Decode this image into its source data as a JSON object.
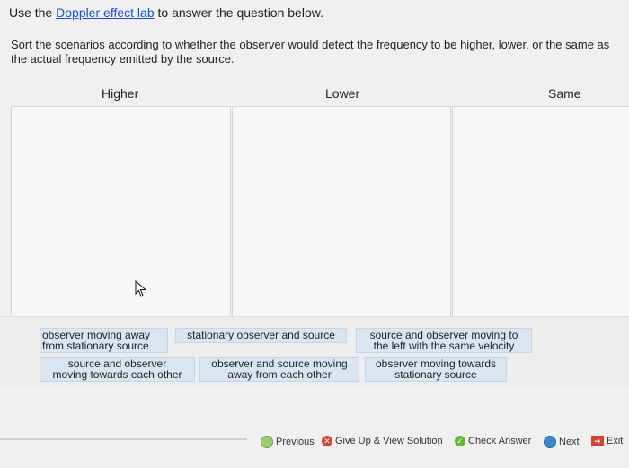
{
  "intro": {
    "before": "Use the ",
    "link": "Doppler effect lab",
    "after": " to answer the question below."
  },
  "prompt": "Sort the scenarios according to whether the observer would detect the frequency to be higher, lower, or the same as the actual frequency emitted by the source.",
  "columns": [
    "Higher",
    "Lower",
    "Same"
  ],
  "chips": [
    {
      "l1": "observer moving away",
      "l2": "from stationary source"
    },
    {
      "l1": "stationary observer and source",
      "l2": ""
    },
    {
      "l1": "source and observer moving to",
      "l2": "the left with the same velocity"
    },
    {
      "l1": "source and observer",
      "l2": "moving towards each other"
    },
    {
      "l1": "observer and source moving",
      "l2": "away from each other"
    },
    {
      "l1": "observer moving towards",
      "l2": "stationary source"
    }
  ],
  "nav": {
    "previous": "Previous",
    "give_up": "Give Up & View Solution",
    "check": "Check Answer",
    "next": "Next",
    "exit": "Exit"
  },
  "colors": {
    "chip_bg": "#d9e6f2",
    "link": "#1a4fd6",
    "check_green": "#5fb836",
    "giveup_red": "#d8432f",
    "next_blue": "#3b86c9"
  }
}
